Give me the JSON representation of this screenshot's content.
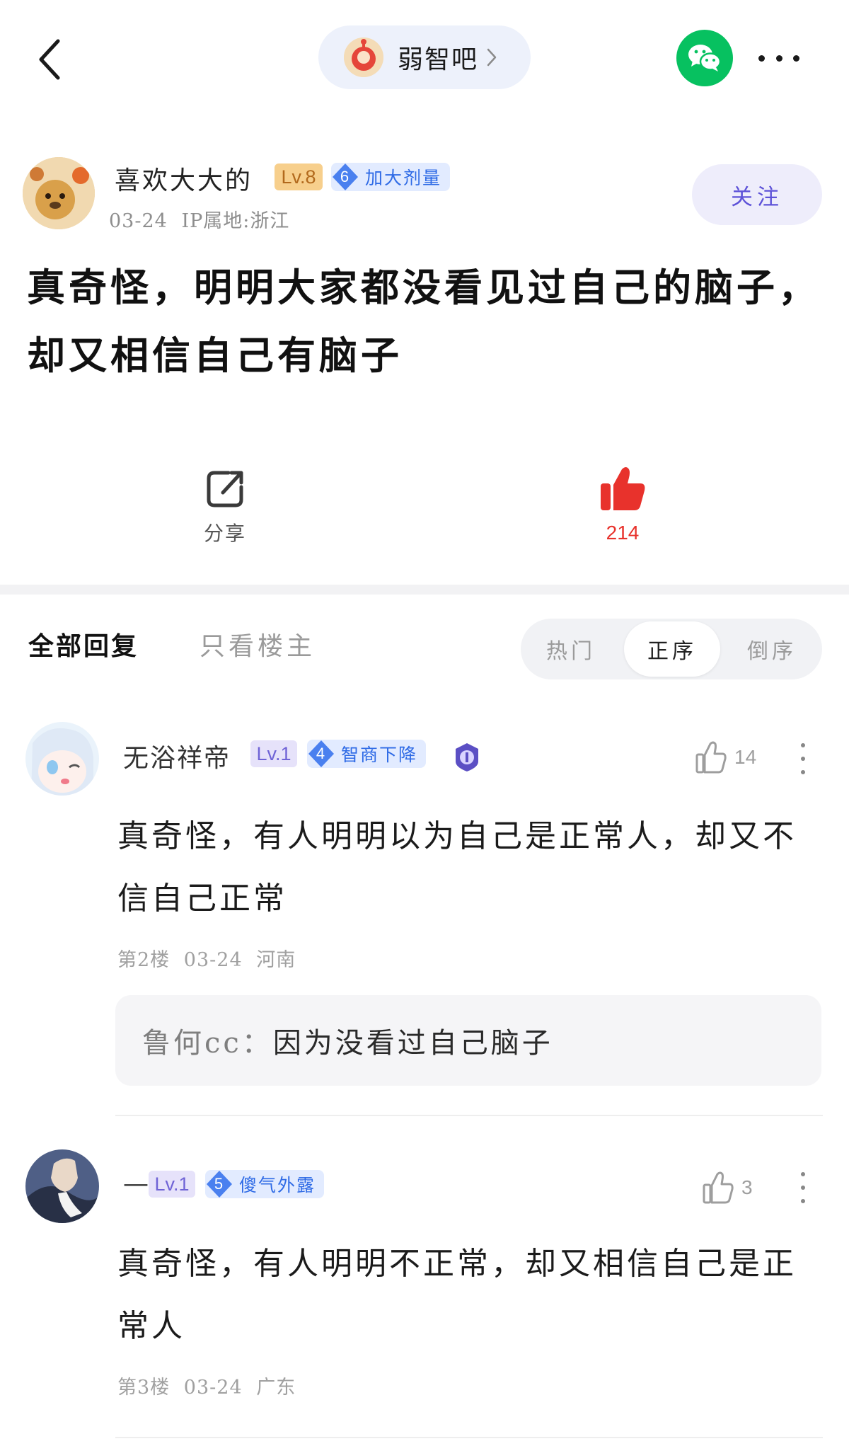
{
  "header": {
    "forum_name": "弱智吧",
    "back_icon": "chevron-left-icon",
    "share_wechat_icon": "wechat-icon",
    "more_icon": "more-horizontal-icon"
  },
  "post": {
    "author": {
      "name": "喜欢大大的",
      "level": "Lv.8",
      "badge_num": "6",
      "badge_title": "加大剂量",
      "date": "03-24",
      "ip": "IP属地:浙江"
    },
    "follow_label": "关注",
    "title": "真奇怪，明明大家都没看见过自己的脑子，却又相信自己有脑子",
    "share_label": "分享",
    "like_count": "214"
  },
  "replies_bar": {
    "tab_all": "全部回复",
    "tab_op": "只看楼主",
    "sort": [
      "热门",
      "正序",
      "倒序"
    ],
    "active_sort": "正序"
  },
  "comments": [
    {
      "name": "无浴祥帝",
      "level": "Lv.1",
      "badge_num": "4",
      "badge_title": "智商下降",
      "likes": "14",
      "body": "真奇怪，有人明明以为自己是正常人，却又不信自己正常",
      "floor": "第2楼",
      "date": "03-24",
      "location": "河南",
      "sub_reply": {
        "name": "鲁何cc：",
        "text": "因为没看过自己脑子"
      }
    },
    {
      "name": "—",
      "level": "Lv.1",
      "badge_num": "5",
      "badge_title": "傻气外露",
      "likes": "3",
      "body": "真奇怪，有人明明不正常，却又相信自己是正常人",
      "floor": "第3楼",
      "date": "03-24",
      "location": "广东"
    }
  ],
  "colors": {
    "like_red": "#e8322c",
    "wechat_green": "#07c160",
    "follow_purple": "#5d52d8",
    "badge_blue": "#2f6be6"
  }
}
